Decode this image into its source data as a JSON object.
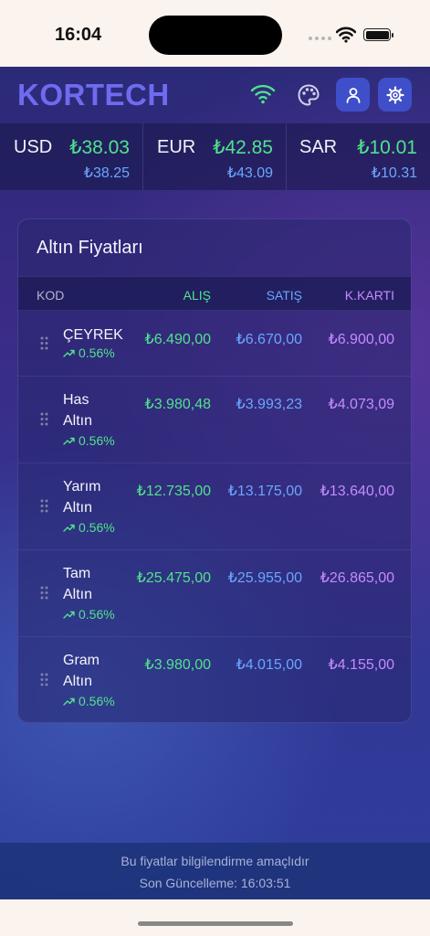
{
  "status_bar": {
    "time": "16:04"
  },
  "app": {
    "logo": "KORTECH",
    "colors": {
      "buy": "#4fe38c",
      "sell": "#6aa6ff",
      "card": "#c48bff",
      "logo": "#6f6bf0"
    }
  },
  "currencies": [
    {
      "code": "USD",
      "buy": "₺38.03",
      "sell": "₺38.25"
    },
    {
      "code": "EUR",
      "buy": "₺42.85",
      "sell": "₺43.09"
    },
    {
      "code": "SAR",
      "buy": "₺10.01",
      "sell": "₺10.31"
    }
  ],
  "gold": {
    "title": "Altın Fiyatları",
    "headers": {
      "kod": "KOD",
      "alis": "ALIŞ",
      "satis": "SATIŞ",
      "kart": "K.KARTI"
    },
    "rows": [
      {
        "name1": "ÇEYREK",
        "name2": "",
        "change": "0.56%",
        "alis": "₺6.490,00",
        "satis": "₺6.670,00",
        "kart": "₺6.900,00"
      },
      {
        "name1": "Has",
        "name2": "Altın",
        "change": "0.56%",
        "alis": "₺3.980,48",
        "satis": "₺3.993,23",
        "kart": "₺4.073,09"
      },
      {
        "name1": "Yarım",
        "name2": "Altın",
        "change": "0.56%",
        "alis": "₺12.735,00",
        "satis": "₺13.175,00",
        "kart": "₺13.640,00"
      },
      {
        "name1": "Tam",
        "name2": "Altın",
        "change": "0.56%",
        "alis": "₺25.475,00",
        "satis": "₺25.955,00",
        "kart": "₺26.865,00"
      },
      {
        "name1": "Gram",
        "name2": "Altın",
        "change": "0.56%",
        "alis": "₺3.980,00",
        "satis": "₺4.015,00",
        "kart": "₺4.155,00"
      }
    ]
  },
  "footer": {
    "disclaimer": "Bu fiyatlar bilgilendirme amaçlıdır",
    "updated": "Son Güncelleme: 16:03:51"
  }
}
